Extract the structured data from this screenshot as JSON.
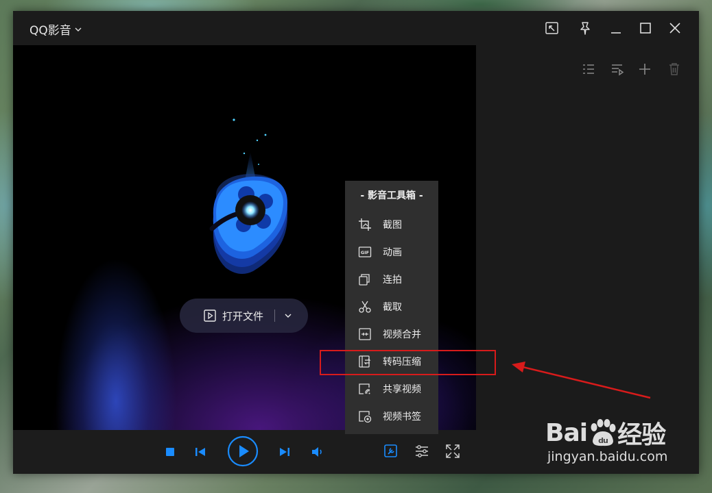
{
  "window": {
    "title": "QQ影音",
    "title_chevron_icon": "chevron-down-icon",
    "buttons": [
      "mini-mode-icon",
      "pin-icon",
      "minimize-icon",
      "maximize-icon",
      "close-icon"
    ]
  },
  "playlist_toolbar": [
    "list-view-icon",
    "play-order-icon",
    "add-icon",
    "delete-icon"
  ],
  "player": {
    "open_file_label": "打开文件",
    "open_file_icon": "play-file-icon"
  },
  "toolbox": {
    "title": "- 影音工具箱 -",
    "items": [
      {
        "label": "截图",
        "icon": "screenshot-icon"
      },
      {
        "label": "动画",
        "icon": "gif-icon"
      },
      {
        "label": "连拍",
        "icon": "burst-icon"
      },
      {
        "label": "截取",
        "icon": "scissors-icon"
      },
      {
        "label": "视频合并",
        "icon": "merge-icon"
      },
      {
        "label": "转码压缩",
        "icon": "transcode-icon"
      },
      {
        "label": "共享视频",
        "icon": "share-icon"
      },
      {
        "label": "视频书签",
        "icon": "bookmark-icon"
      }
    ],
    "highlighted_item": "转码压缩"
  },
  "controls": [
    "stop-icon",
    "previous-icon",
    "play-icon",
    "next-icon",
    "volume-icon",
    "toolbox-icon",
    "settings-icon",
    "fullscreen-icon"
  ],
  "watermark": {
    "brand": "Bai経验",
    "brand_left": "Bai",
    "brand_mid": "du",
    "brand_right": "经验",
    "url": "jingyan.baidu.com"
  },
  "colors": {
    "accent": "#1a8cff",
    "window_bg": "#1b1b1b",
    "menu_bg": "#2f2f2f",
    "annotation": "#d81b1b"
  }
}
